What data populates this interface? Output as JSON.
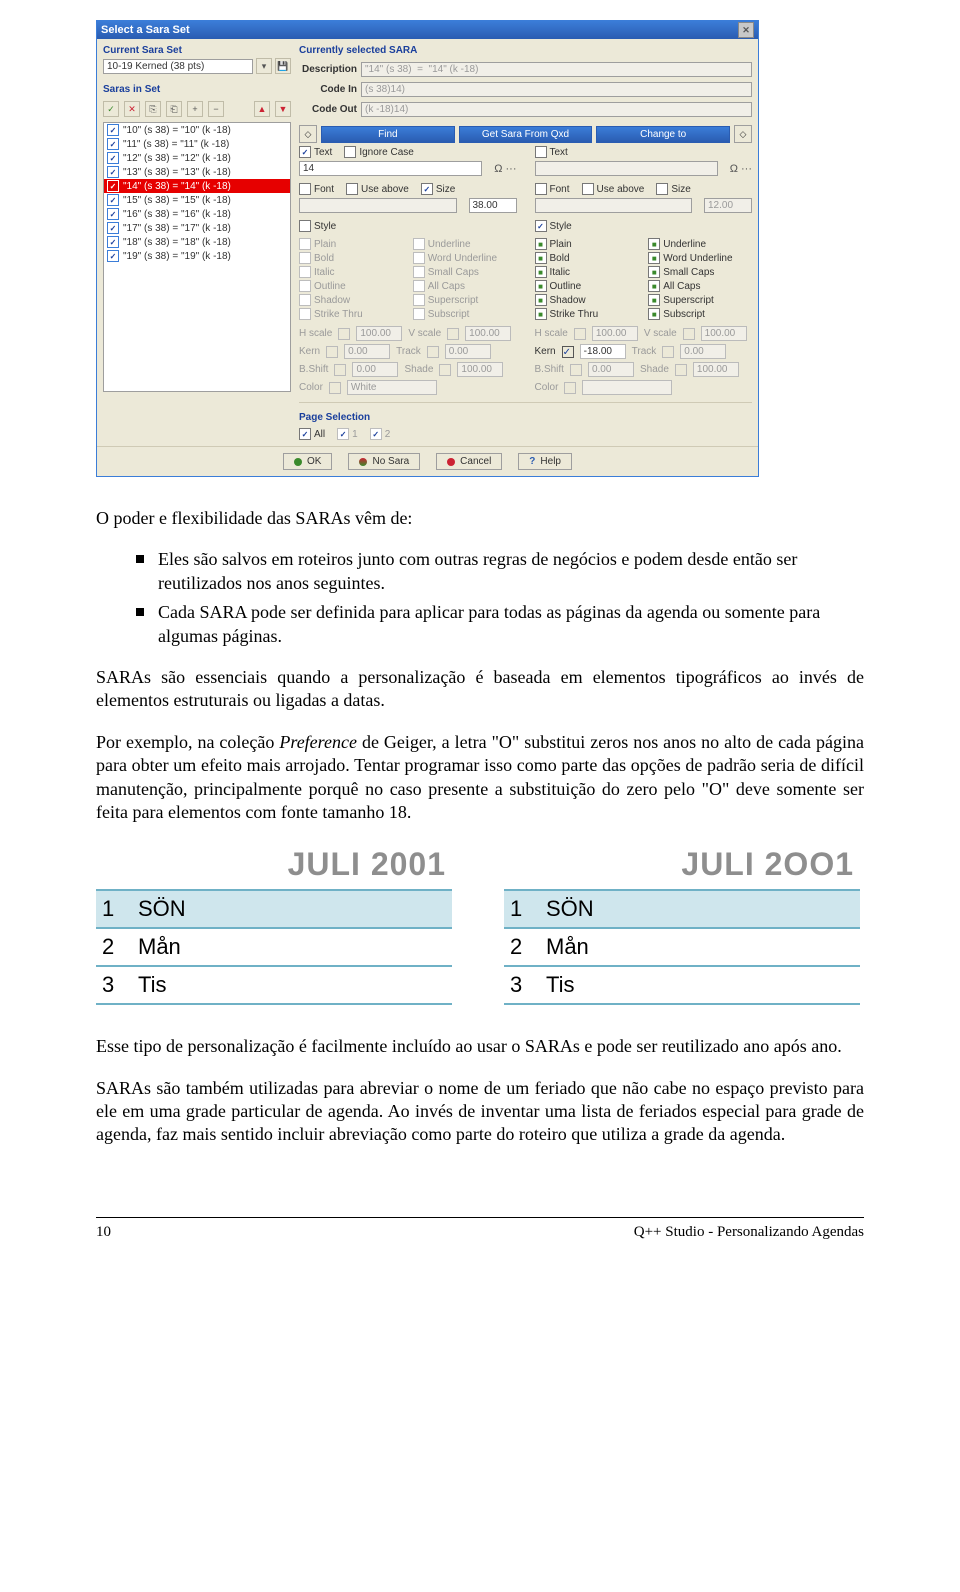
{
  "dialog": {
    "title": "Select a Sara Set",
    "currentSet": {
      "label": "Current Sara Set",
      "value": "10-19 Kerned (38 pts)"
    },
    "sarasInSet": {
      "label": "Saras in Set",
      "items": [
        "\"10\" (s 38)  =  \"10\" (k -18)",
        "\"11\" (s 38)  =  \"11\" (k -18)",
        "\"12\" (s 38)  =  \"12\" (k -18)",
        "\"13\" (s 38)  =  \"13\" (k -18)",
        "\"14\" (s 38)  =  \"14\" (k -18)",
        "\"15\" (s 38)  =  \"15\" (k -18)",
        "\"16\" (s 38)  =  \"16\" (k -18)",
        "\"17\" (s 38)  =  \"17\" (k -18)",
        "\"18\" (s 38)  =  \"18\" (k -18)",
        "\"19\" (s 38)  =  \"19\" (k -18)"
      ],
      "selectedIndex": 4
    },
    "currentlySelected": {
      "label": "Currently selected SARA"
    },
    "description": {
      "label": "Description",
      "value": "\"14\" (s 38)  =  \"14\" (k -18)"
    },
    "codeIn": {
      "label": "Code In",
      "value": "(s 38)14)"
    },
    "codeOut": {
      "label": "Code Out",
      "value": "(k -18)14)"
    },
    "findHeader": "Find",
    "getSara": "Get Sara From Qxd",
    "changeHeader": "Change to",
    "find": {
      "text": {
        "label": "Text",
        "value": "14"
      },
      "ignoreCase": "Ignore Case",
      "font": "Font",
      "useAbove": "Use above",
      "size": "Size",
      "sizeVal": "38.00",
      "style": "Style",
      "styles": [
        "Plain",
        "Underline",
        "Bold",
        "Word Underline",
        "Italic",
        "Small Caps",
        "Outline",
        "All Caps",
        "Shadow",
        "Superscript",
        "Strike Thru",
        "Subscript"
      ],
      "hscale": "H scale",
      "vscale": "V scale",
      "hv": "100.00",
      "kern": "Kern",
      "kernv": "0.00",
      "track": "Track",
      "trackv": "0.00",
      "bshift": "B.Shift",
      "bsv": "0.00",
      "shade": "Shade",
      "shv": "100.00",
      "color": "Color",
      "colorv": "White"
    },
    "change": {
      "text": {
        "label": "Text"
      },
      "font": "Font",
      "useAbove": "Use above",
      "size": "Size",
      "sizeVal": "12.00",
      "style": "Style",
      "styles": [
        "Plain",
        "Underline",
        "Bold",
        "Word Underline",
        "Italic",
        "Small Caps",
        "Outline",
        "All Caps",
        "Shadow",
        "Superscript",
        "Strike Thru",
        "Subscript"
      ],
      "hscale": "H scale",
      "vscale": "V scale",
      "hv": "100.00",
      "kern": "Kern",
      "kernv": "-18.00",
      "track": "Track",
      "trackv": "0.00",
      "bshift": "B.Shift",
      "bsv": "0.00",
      "shade": "Shade",
      "shv": "100.00",
      "color": "Color"
    },
    "pageSel": {
      "label": "Page Selection",
      "all": "All",
      "one": "1",
      "two": "2"
    },
    "buttons": {
      "ok": "OK",
      "nosara": "No Sara",
      "cancel": "Cancel",
      "help": "Help"
    }
  },
  "text": {
    "p1": "O poder e flexibilidade das SARAs vêm de:",
    "b1": "Eles são salvos em roteiros junto com outras regras de negócios e podem desde então ser reutilizados nos anos seguintes.",
    "b2": "Cada SARA pode ser definida para aplicar para todas as páginas da agenda ou somente para algumas páginas.",
    "p2": "SARAs são essenciais quando a personalização é baseada em elementos tipográficos ao invés de elementos estruturais ou ligadas a datas.",
    "p3a": "Por exemplo, na coleção ",
    "p3i": "Preference",
    "p3b": " de Geiger, a letra \"O\" substitui zeros nos anos no alto de cada página para obter um efeito mais arrojado. Tentar programar isso como parte das opções de padrão seria de difícil manutenção, principalmente porquê no caso presente a substituição do zero pelo \"O\" deve somente ser feita para elementos com fonte tamanho 18.",
    "p4": "Esse tipo de personalização é facilmente incluído ao usar o SARAs e pode ser reutilizado ano após ano.",
    "p5": "SARAs são também utilizadas para abreviar o nome de um feriado que não cabe no espaço previsto para ele em uma grade particular de agenda. Ao invés de inventar uma lista de feriados especial para grade de agenda, faz mais sentido incluir abreviação como parte do roteiro que utiliza a grade da agenda."
  },
  "juli": {
    "left": {
      "title": "JULI 2001"
    },
    "right": {
      "title": "JULI 2OO1"
    },
    "rows": [
      {
        "n": "1",
        "d": "SÖN"
      },
      {
        "n": "2",
        "d": "Mån"
      },
      {
        "n": "3",
        "d": "Tis"
      }
    ]
  },
  "footer": {
    "left": "10",
    "right": "Q++ Studio - Personalizando Agendas"
  }
}
